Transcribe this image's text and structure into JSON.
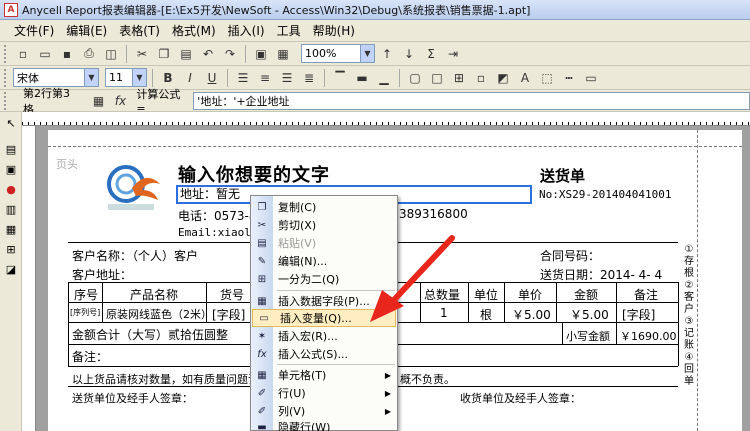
{
  "window": {
    "title": "Anycell Report报表编辑器-[E:\\Ex5开发\\NewSoft - Access\\Win32\\Debug\\系统报表\\销售票据-1.apt]"
  },
  "menubar": [
    "文件(F)",
    "编辑(E)",
    "表格(T)",
    "格式(M)",
    "插入(I)",
    "工具",
    "帮助(H)"
  ],
  "toolbar": {
    "zoom": "100%",
    "font_name": "宋体",
    "font_size": "11",
    "bold": "B",
    "italic": "I",
    "underline": "U"
  },
  "formula_bar": {
    "cell_ref": "第2行第3格",
    "fx": "fx",
    "label": "计算公式=",
    "value": "'地址：'+企业地址"
  },
  "report": {
    "page_header_tag": "页头",
    "big_title": "输入你想要的文字",
    "doc_title": "送货单",
    "address": "地址：暂无",
    "number": "No:XS29-201404041001",
    "tel": "电话：0573-8",
    "qq": "389316800",
    "email": "Email:xiaol",
    "customer_name": "客户名称：（个人）客户",
    "contract_no": "合同号码：",
    "customer_addr": "客户地址：",
    "delivery_date": "送货日期：2014- 4- 4",
    "headers": [
      "序号",
      "产品名称",
      "货号",
      "总数量",
      "单位",
      "单价",
      "金额",
      "备注"
    ],
    "row": {
      "seq_marker": "[序列号]",
      "product": "原装网线蓝色（2米）",
      "code": "[字段]",
      "qty": "1",
      "unit": "根",
      "price": "￥5.00",
      "amount": "￥5.00",
      "remark": "[字段]"
    },
    "total_words": "金额合计（大写）贰拾伍圆整",
    "total_small_label": "小写金额",
    "total_small": "￥1690.00",
    "remark_label": "备注：",
    "notice": "以上货品请核对数量，如有质量问题请",
    "notice_tail": "概不负责。",
    "signer_left": "送货单位及经手人签章：",
    "signer_right": "收货单位及经手人签章：",
    "side_label": "①存根②客户③记账④回单"
  },
  "context_menu": [
    {
      "label": "复制(C)",
      "icon": "copy-icon",
      "disabled": false
    },
    {
      "label": "剪切(X)",
      "icon": "cut-icon",
      "disabled": false
    },
    {
      "label": "粘贴(V)",
      "icon": "paste-icon",
      "disabled": true
    },
    {
      "label": "编辑(N)...",
      "icon": "edit-icon",
      "disabled": false
    },
    {
      "label": "一分为二(Q)",
      "icon": "split-icon",
      "disabled": false
    },
    {
      "label": "插入数据字段(P)...",
      "icon": "insert-field-icon",
      "disabled": false
    },
    {
      "label": "插入变量(Q)...",
      "icon": "insert-variable-icon",
      "disabled": false,
      "highlighted": true
    },
    {
      "label": "插入宏(R)...",
      "icon": "insert-macro-icon",
      "disabled": false
    },
    {
      "label": "插入公式(S)...",
      "icon": "insert-formula-icon",
      "disabled": false
    },
    {
      "label": "单元格(T)",
      "icon": "cell-icon",
      "disabled": false,
      "submenu": true
    },
    {
      "label": "行(U)",
      "icon": "row-icon",
      "disabled": false,
      "submenu": true
    },
    {
      "label": "列(V)",
      "icon": "column-icon",
      "disabled": false,
      "submenu": true
    },
    {
      "label": "隐藏行(W)",
      "icon": "hide-row-icon",
      "disabled": false
    }
  ],
  "colors": {
    "selection": "#2b6fe0",
    "highlight": "#ffeec2",
    "arrow": "#e8261c"
  }
}
